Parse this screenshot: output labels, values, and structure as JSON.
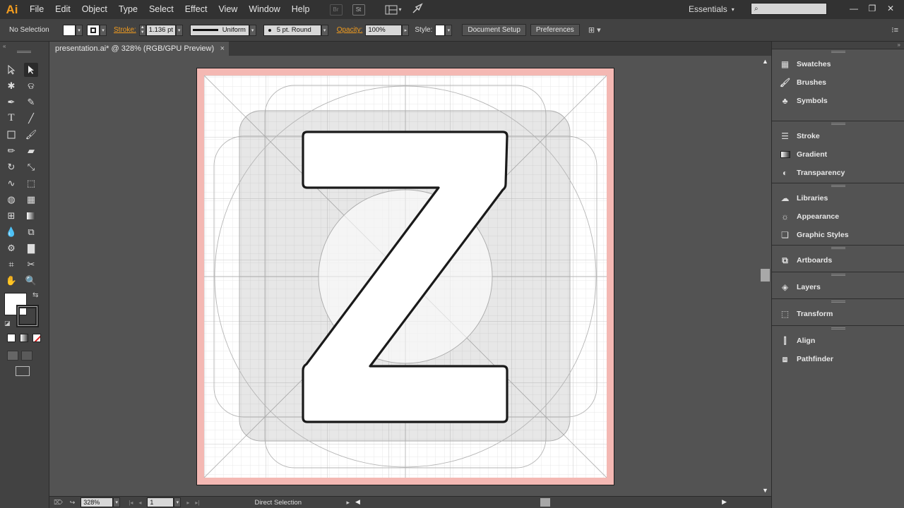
{
  "app": {
    "logo": "Ai"
  },
  "menu": [
    "File",
    "Edit",
    "Object",
    "Type",
    "Select",
    "Effect",
    "View",
    "Window",
    "Help"
  ],
  "menubar_icons": {
    "bridge": "Br",
    "stock": "St"
  },
  "workspace": {
    "label": "Essentials",
    "search_placeholder": ""
  },
  "control": {
    "selection": "No Selection",
    "stroke_label": "Stroke:",
    "stroke_weight": "1.136 pt",
    "profile": "Uniform",
    "brush": "5 pt. Round",
    "opacity_label": "Opacity:",
    "opacity": "100%",
    "style_label": "Style:",
    "document_setup": "Document Setup",
    "preferences": "Preferences"
  },
  "document": {
    "tab": "presentation.ai* @ 328% (RGB/GPU Preview)",
    "close": "×"
  },
  "status": {
    "zoom": "328%",
    "artboard": "1",
    "tool": "Direct Selection"
  },
  "panels": {
    "groups": [
      {
        "items": [
          {
            "icon": "swatches-icon",
            "label": "Swatches"
          },
          {
            "icon": "brushes-icon",
            "label": "Brushes"
          },
          {
            "icon": "symbols-icon",
            "label": "Symbols"
          }
        ]
      },
      {
        "items": [
          {
            "icon": "stroke-icon",
            "label": "Stroke"
          },
          {
            "icon": "gradient-icon",
            "label": "Gradient"
          },
          {
            "icon": "transparency-icon",
            "label": "Transparency"
          }
        ]
      },
      {
        "items": [
          {
            "icon": "libraries-icon",
            "label": "Libraries"
          },
          {
            "icon": "appearance-icon",
            "label": "Appearance"
          },
          {
            "icon": "graphic-styles-icon",
            "label": "Graphic Styles"
          }
        ]
      },
      {
        "items": [
          {
            "icon": "artboards-icon",
            "label": "Artboards"
          }
        ]
      },
      {
        "items": [
          {
            "icon": "layers-icon",
            "label": "Layers"
          }
        ]
      },
      {
        "items": [
          {
            "icon": "transform-icon",
            "label": "Transform"
          }
        ]
      },
      {
        "items": [
          {
            "icon": "align-icon",
            "label": "Align"
          },
          {
            "icon": "pathfinder-icon",
            "label": "Pathfinder"
          }
        ]
      }
    ]
  },
  "colors": {
    "accent": "#f29c1f",
    "bleed": "#f4b8b3",
    "grid": "#dadada",
    "guide": "#b5b5b5"
  },
  "artwork": {
    "letter": "Z"
  }
}
